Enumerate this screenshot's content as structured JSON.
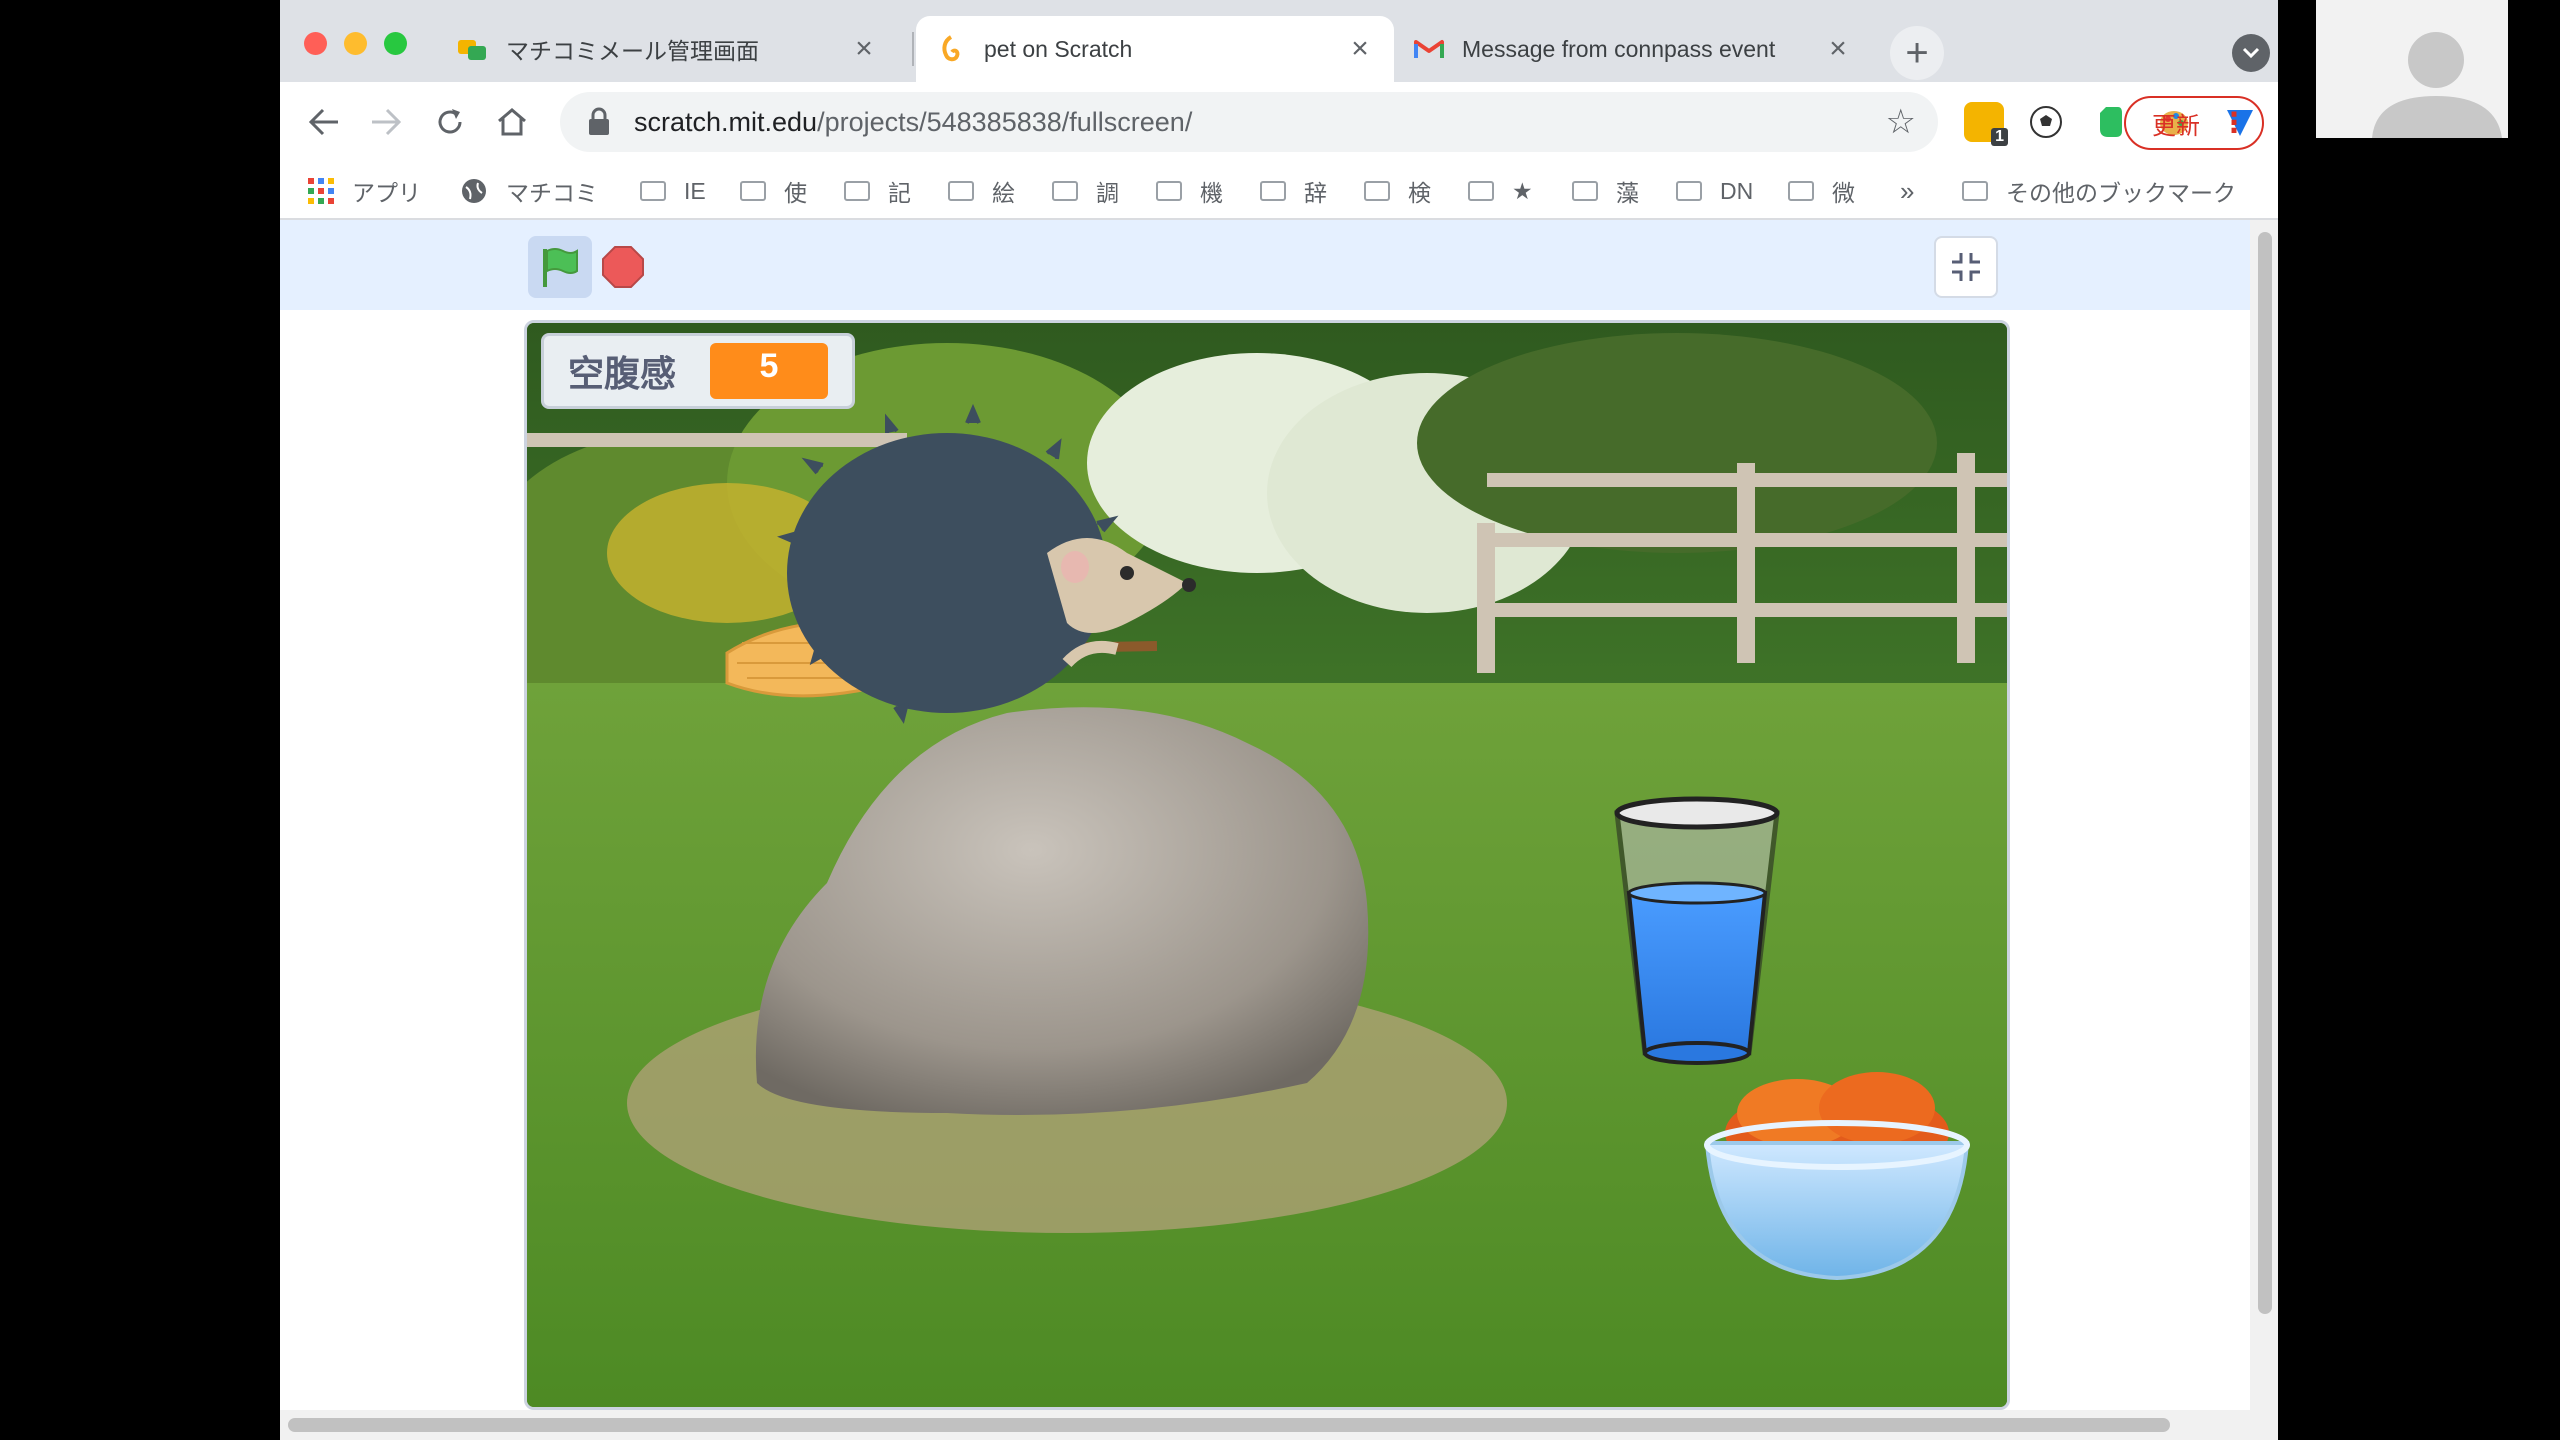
{
  "tabs": [
    {
      "title": "マチコミメール管理画面",
      "favicon": "machicomi-icon"
    },
    {
      "title": "pet on Scratch",
      "favicon": "scratch-icon"
    },
    {
      "title": "Message from connpass event",
      "favicon": "gmail-icon"
    }
  ],
  "tab_close_glyph": "×",
  "new_tab_glyph": "+",
  "url": {
    "host": "scratch.mit.edu",
    "path": "/projects/548385838/fullscreen/"
  },
  "update_button": "更新",
  "extension_badge": "1",
  "bookmarks": [
    {
      "label": "アプリ",
      "icon": "apps-grid-icon"
    },
    {
      "label": "マチコミ",
      "icon": "globe-icon"
    },
    {
      "label": "IE"
    },
    {
      "label": "使"
    },
    {
      "label": "記"
    },
    {
      "label": "絵"
    },
    {
      "label": "調"
    },
    {
      "label": "機"
    },
    {
      "label": "辞"
    },
    {
      "label": "検"
    },
    {
      "label": "★"
    },
    {
      "label": "藻"
    },
    {
      "label": "DN"
    },
    {
      "label": "微"
    }
  ],
  "bookmarks_overflow": "»",
  "other_bookmarks": "その他のブックマーク",
  "monitor": {
    "label": "空腹感",
    "value": "5"
  },
  "colors": {
    "monitor_orange": "#ff8c1a",
    "close_red": "#ff5f57",
    "minimize_yellow": "#febc2e",
    "zoom_green": "#28c840",
    "scratch_flag_green": "#4cbf56",
    "stop_red": "#ec5959"
  }
}
